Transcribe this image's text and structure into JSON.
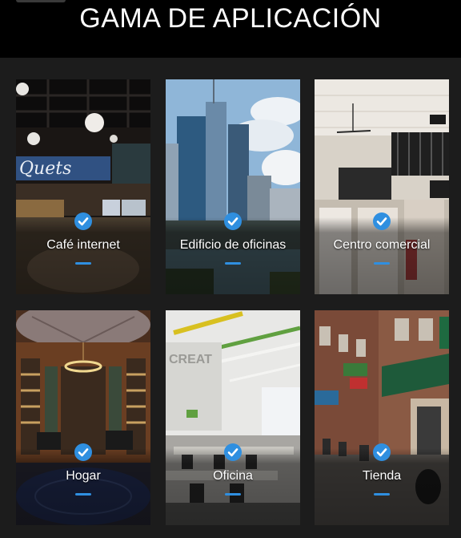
{
  "header": {
    "title": "GAMA DE APLICACIÓN"
  },
  "accent_color": "#2f8fe0",
  "cards": [
    {
      "label": "Café internet",
      "icon": "check-circle-icon"
    },
    {
      "label": "Edificio de oficinas",
      "icon": "check-circle-icon"
    },
    {
      "label": "Centro comercial",
      "icon": "check-circle-icon"
    },
    {
      "label": "Hogar",
      "icon": "check-circle-icon"
    },
    {
      "label": "Oficina",
      "icon": "check-circle-icon"
    },
    {
      "label": "Tienda",
      "icon": "check-circle-icon"
    }
  ]
}
